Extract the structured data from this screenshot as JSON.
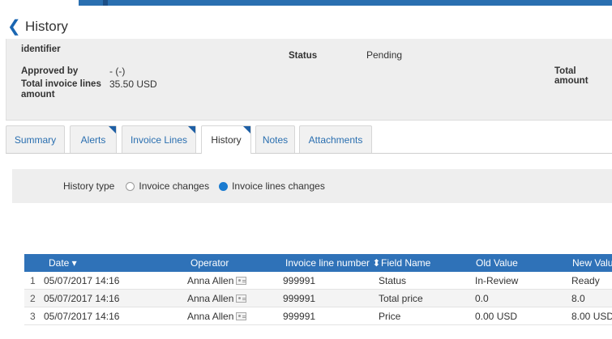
{
  "header": {
    "title": "History"
  },
  "summary": {
    "identifier_label": "identifier",
    "approved_by_label": "Approved by",
    "approved_by_value": "- (-)",
    "total_lines_label_1": "Total invoice lines",
    "total_lines_label_2": "amount",
    "total_lines_value": "35.50 USD",
    "status_label": "Status",
    "status_value": "Pending",
    "total_amount_label": "Total amount"
  },
  "tabs": [
    {
      "label": "Summary"
    },
    {
      "label": "Alerts"
    },
    {
      "label": "Invoice Lines"
    },
    {
      "label": "History"
    },
    {
      "label": "Notes"
    },
    {
      "label": "Attachments"
    }
  ],
  "history_type": {
    "label": "History type",
    "options": [
      {
        "label": "Invoice changes",
        "selected": false
      },
      {
        "label": "Invoice lines changes",
        "selected": true
      }
    ]
  },
  "table": {
    "columns": {
      "date": "Date ▾",
      "operator": "Operator",
      "line_number": "Invoice line number ⬍",
      "field_name": "Field Name",
      "old_value": "Old Value",
      "new_value": "New Value"
    },
    "rows": [
      {
        "idx": "1",
        "date": "05/07/2017 14:16",
        "operator": "Anna Allen",
        "line_number": "999991",
        "field_name": "Status",
        "old_value": "In-Review",
        "new_value": "Ready"
      },
      {
        "idx": "2",
        "date": "05/07/2017 14:16",
        "operator": "Anna Allen",
        "line_number": "999991",
        "field_name": "Total price",
        "old_value": "0.0",
        "new_value": "8.0"
      },
      {
        "idx": "3",
        "date": "05/07/2017 14:16",
        "operator": "Anna Allen",
        "line_number": "999991",
        "field_name": "Price",
        "old_value": "0.00 USD",
        "new_value": "8.00 USD"
      }
    ]
  },
  "colors": {
    "accent": "#2f72b8",
    "link": "#2a6fb0",
    "panel": "#eeeeee",
    "radio_on": "#1a7bd0"
  }
}
